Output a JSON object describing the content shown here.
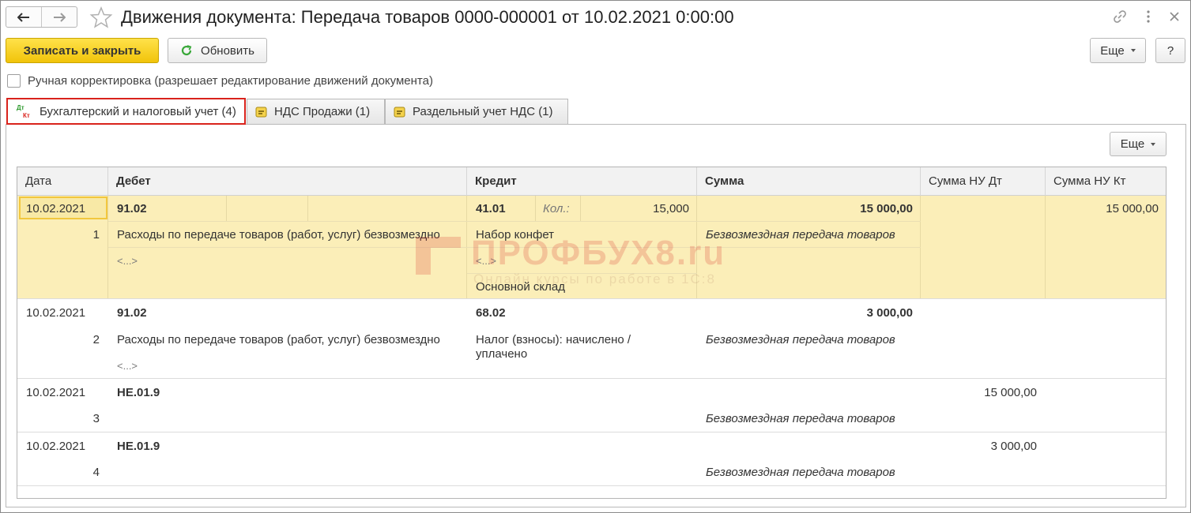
{
  "window": {
    "title": "Движения документа: Передача товаров 0000-000001 от 10.02.2021 0:00:00"
  },
  "toolbar": {
    "save_close_label": "Записать и закрыть",
    "refresh_label": "Обновить",
    "more_label": "Еще",
    "help_label": "?"
  },
  "manual": {
    "label": "Ручная корректировка (разрешает редактирование движений документа)",
    "checked": false
  },
  "tabs": [
    {
      "label": "Бухгалтерский и налоговый учет (4)",
      "icon_text_top": "Дт",
      "icon_text_bottom": "Кт"
    },
    {
      "label": "НДС Продажи (1)"
    },
    {
      "label": "Раздельный учет НДС (1)"
    }
  ],
  "panel": {
    "more_label": "Еще"
  },
  "table": {
    "columns": [
      "Дата",
      "Дебет",
      "Кредит",
      "Сумма",
      "Сумма НУ Дт",
      "Сумма НУ Кт"
    ],
    "rows": [
      {
        "date": "10.02.2021",
        "num": "1",
        "debit_account": "91.02",
        "debit_desc": "Расходы по передаче товаров (работ, услуг) безвозмездно",
        "debit_sub": "<...>",
        "credit_account": "41.01",
        "qty_label": "Кол.:",
        "qty_value": "15,000",
        "credit_desc": "Набор конфет",
        "credit_sub": "<...>",
        "credit_sub2": "Основной склад",
        "sum": "15 000,00",
        "comment": "Безвозмездная передача товаров",
        "nu_dt": "",
        "nu_kt": "15 000,00"
      },
      {
        "date": "10.02.2021",
        "num": "2",
        "debit_account": "91.02",
        "debit_desc": "Расходы по передаче товаров (работ, услуг) безвозмездно",
        "debit_sub": "<...>",
        "credit_account": "68.02",
        "credit_desc_line1": "Налог (взносы): начислено /",
        "credit_desc_line2": "уплачено",
        "sum": "3 000,00",
        "comment": "Безвозмездная передача товаров",
        "nu_dt": "",
        "nu_kt": ""
      },
      {
        "date": "10.02.2021",
        "num": "3",
        "debit_account": "НЕ.01.9",
        "sum": "",
        "comment": "Безвозмездная передача товаров",
        "nu_dt": "15 000,00",
        "nu_kt": ""
      },
      {
        "date": "10.02.2021",
        "num": "4",
        "debit_account": "НЕ.01.9",
        "sum": "",
        "comment": "Безвозмездная передача товаров",
        "nu_dt": "3 000,00",
        "nu_kt": ""
      }
    ]
  },
  "watermark": {
    "text": "ПРОФБУХ8.ru",
    "subtext": "Онлайн курсы по работе в 1С:8"
  },
  "colors": {
    "primary_button": "#f5cd1c",
    "selected_row": "#fbeeb8",
    "active_tab_border": "#d9231c",
    "refresh_icon": "#3aa83a"
  }
}
